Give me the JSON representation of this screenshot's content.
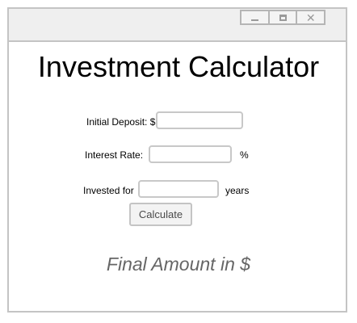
{
  "window": {
    "controls": {
      "minimize_label": "minimize",
      "maximize_label": "maximize",
      "close_symbol": "✕"
    }
  },
  "app": {
    "title": "Investment Calculator",
    "fields": {
      "deposit": {
        "label": "Initial Deposit: $",
        "value": "",
        "placeholder": ""
      },
      "rate": {
        "label": "Interest Rate:",
        "suffix": "%",
        "value": "",
        "placeholder": ""
      },
      "duration": {
        "label": "Invested for",
        "suffix": "years",
        "value": "",
        "placeholder": ""
      }
    },
    "calculate_label": "Calculate",
    "result_text": "Final Amount in $"
  },
  "colors": {
    "border": "#c4c4c4",
    "titlebar": "#efefef",
    "result_text": "#666666"
  },
  "icons": {
    "minimize": "minimize-icon",
    "maximize": "maximize-icon",
    "close": "close-icon"
  }
}
